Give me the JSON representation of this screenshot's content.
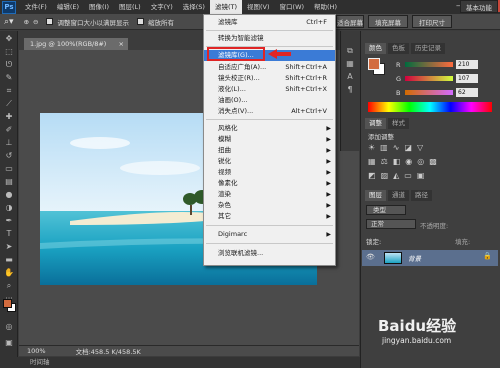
{
  "app": {
    "logo": "Ps"
  },
  "menubar": [
    "文件(F)",
    "编辑(E)",
    "图像(I)",
    "图层(L)",
    "文字(Y)",
    "选择(S)",
    "滤镜(T)",
    "视图(V)",
    "窗口(W)",
    "帮助(H)"
  ],
  "window_controls": [
    "—",
    "□",
    "✕"
  ],
  "options_bar": {
    "checkbox1_label": "调整窗口大小以满屏显示",
    "checkbox2_label": "缩放所有",
    "btn_screen": "适合屏幕",
    "btn_fill": "填充屏幕",
    "btn_print": "打印尺寸",
    "workspace": "基本功能"
  },
  "document": {
    "tab_title": "1.jpg @ 100%(RGB/8#)",
    "close": "×",
    "zoom": "100%",
    "doc_size": "文档:458.5 K/458.5K"
  },
  "bottom_bar": {
    "label": "时间轴"
  },
  "filter_menu": {
    "items": [
      {
        "label": "滤镜库",
        "shortcut": "Ctrl+F"
      },
      {
        "label": "转换为智能滤镜",
        "shortcut": ""
      },
      {
        "label": "滤镜库(G)...",
        "shortcut": ""
      },
      {
        "label": "自适应广角(A)...",
        "shortcut": "Shift+Ctrl+A"
      },
      {
        "label": "镜头校正(R)...",
        "shortcut": "Shift+Ctrl+R"
      },
      {
        "label": "液化(L)...",
        "shortcut": "Shift+Ctrl+X"
      },
      {
        "label": "油画(O)...",
        "shortcut": ""
      },
      {
        "label": "消失点(V)...",
        "shortcut": "Alt+Ctrl+V"
      },
      {
        "label": "风格化",
        "shortcut": ""
      },
      {
        "label": "模糊",
        "shortcut": ""
      },
      {
        "label": "扭曲",
        "shortcut": ""
      },
      {
        "label": "锐化",
        "shortcut": ""
      },
      {
        "label": "视频",
        "shortcut": ""
      },
      {
        "label": "像素化",
        "shortcut": ""
      },
      {
        "label": "渲染",
        "shortcut": ""
      },
      {
        "label": "杂色",
        "shortcut": ""
      },
      {
        "label": "其它",
        "shortcut": ""
      },
      {
        "label": "Digimarc",
        "shortcut": ""
      },
      {
        "label": "浏览联机滤镜...",
        "shortcut": ""
      }
    ],
    "highlighted": "滤镜库(G)..."
  },
  "panels": {
    "color_tabs": [
      "颜色",
      "色板",
      "历史记录"
    ],
    "rgb": [
      {
        "label": "R",
        "value": "210"
      },
      {
        "label": "G",
        "value": "107"
      },
      {
        "label": "B",
        "value": "62"
      }
    ],
    "adjust_tabs": [
      "调整",
      "样式"
    ],
    "adjust_title": "添加调整",
    "layers_tabs": [
      "图层",
      "通道",
      "路径"
    ],
    "layer_filter": "类型",
    "blend_mode": "正常",
    "opacity_label": "不透明度:",
    "lock_label": "锁定:",
    "fill_label": "填充:",
    "layer_name": "背景"
  },
  "colors": {
    "foreground": "#d26b3e",
    "background": "#ffffff",
    "highlight": "#3b7bd6",
    "annotation": "#e02525"
  },
  "watermark": {
    "brand": "Baidu经验",
    "url": "jingyan.baidu.com"
  }
}
